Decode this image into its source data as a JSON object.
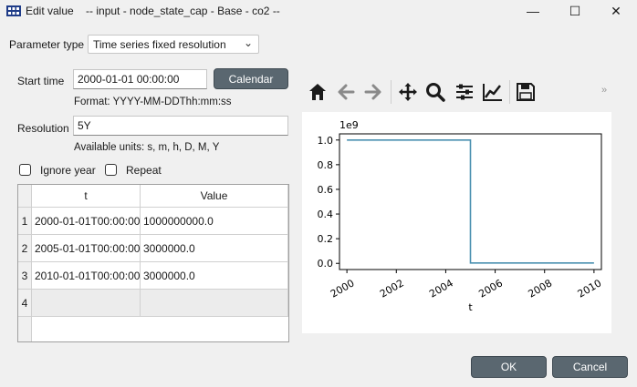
{
  "window": {
    "title": "Edit value    -- input - node_state_cap - Base - co2 --",
    "minimize_glyph": "—",
    "maximize_glyph": "☐",
    "close_glyph": "✕"
  },
  "form": {
    "parameter_type_label": "Parameter type",
    "parameter_type_value": "Time series fixed resolution",
    "start_time_label": "Start time",
    "start_time_value": "2000-01-01 00:00:00",
    "calendar_label": "Calendar",
    "format_hint": "Format: YYYY-MM-DDThh:mm:ss",
    "resolution_label": "Resolution",
    "resolution_value": "5Y",
    "units_hint": "Available units: s, m, h, D, M, Y",
    "ignore_year_label": "Ignore year",
    "ignore_year_checked": false,
    "repeat_label": "Repeat",
    "repeat_checked": false
  },
  "table": {
    "columns": [
      "t",
      "Value"
    ],
    "row_numbers": [
      "1",
      "2",
      "3",
      "4"
    ],
    "rows": [
      [
        "2000-01-01T00:00:00",
        "1000000000.0"
      ],
      [
        "2005-01-01T00:00:00",
        "3000000.0"
      ],
      [
        "2010-01-01T00:00:00",
        "3000000.0"
      ],
      [
        "",
        ""
      ]
    ]
  },
  "toolbar": {
    "icons": [
      "home-icon",
      "back-arrow-icon",
      "forward-arrow-icon",
      "pan-icon",
      "zoom-icon",
      "configure-subplots-icon",
      "edit-axis-icon",
      "save-icon"
    ],
    "more_glyph": "»"
  },
  "chart_data": {
    "type": "line",
    "step": "post",
    "x": [
      2000,
      2005,
      2010
    ],
    "y": [
      1.0,
      0.003,
      0.003
    ],
    "y_scale_label": "1e9",
    "xlabel": "t",
    "ylabel": "",
    "xlim": [
      1999.7,
      2010.3
    ],
    "ylim": [
      -0.05,
      1.05
    ],
    "xticks": [
      "2000",
      "2002",
      "2004",
      "2006",
      "2008",
      "2010"
    ],
    "yticks": [
      "0.0",
      "0.2",
      "0.4",
      "0.6",
      "0.8",
      "1.0"
    ],
    "grid": false,
    "line_color": "#4a90b0"
  },
  "buttons": {
    "ok_label": "OK",
    "cancel_label": "Cancel"
  }
}
